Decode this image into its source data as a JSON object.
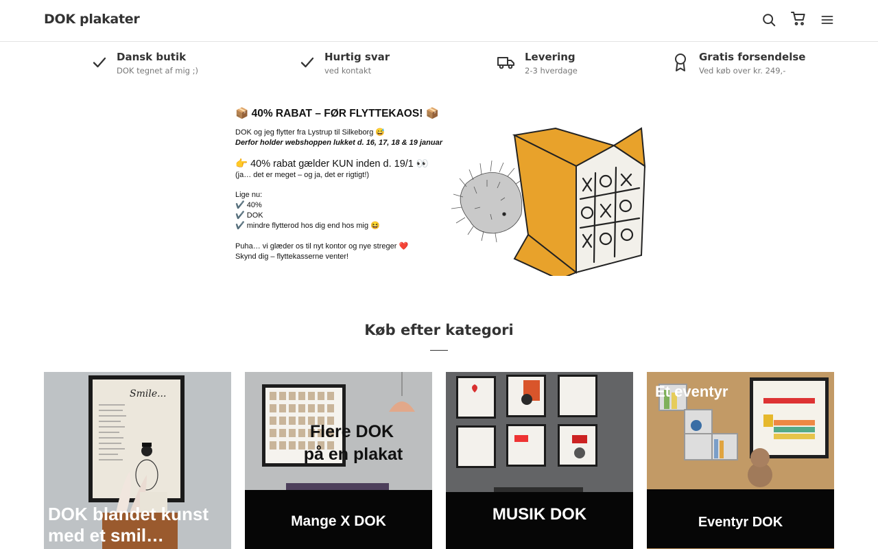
{
  "header": {
    "logo": "DOK plakater",
    "icons": [
      "search-icon",
      "cart-icon",
      "menu-icon"
    ]
  },
  "usps": [
    {
      "title": "Dansk butik",
      "subtitle": "DOK tegnet af mig ;)",
      "icon": "check-icon"
    },
    {
      "title": "Hurtig svar",
      "subtitle": "ved kontakt",
      "icon": "check-icon"
    },
    {
      "title": "Levering",
      "subtitle": "2-3 hverdage",
      "icon": "truck-icon"
    },
    {
      "title": "Gratis forsendelse",
      "subtitle": "Ved køb over kr. 249,-",
      "icon": "award-icon"
    }
  ],
  "banner": {
    "headline": "📦 40% RABAT – FØR FLYTTEKAOS! 📦",
    "line1": "DOK og jeg flytter fra Lystrup til Silkeborg 😅",
    "line2": "Derfor holder webshoppen lukket d. 16, 17, 18 & 19 januar",
    "line3": "👉 40% rabat gælder KUN inden d. 19/1 👀",
    "line4": "(ja… det er meget – og ja, det er rigtigt!)",
    "line5": "Lige nu:",
    "check1": "✔️ 40%",
    "check2": "✔️ DOK",
    "check3": "✔️ mindre flytterod hos dig end hos mig 😆",
    "line6": "Puha… vi glæder os til nyt kontor og nye streger ❤️",
    "line7": "Skynd dig – flyttekasserne venter!"
  },
  "categories_section": {
    "title": "Køb efter kategori"
  },
  "categories": [
    {
      "label_line1": "DOK blandet kunst",
      "label_line2": "med et smil…",
      "poster_text": "Smile..."
    },
    {
      "label_line1": "Mange X  DOK",
      "overlay_line1": "Flere DOK",
      "overlay_line2": "på en plakat"
    },
    {
      "label_line1": "MUSIK DOK"
    },
    {
      "label_line1": "Eventyr DOK",
      "overlay": "Et eventyr"
    }
  ],
  "colors": {
    "text": "#333333",
    "muted": "#777777",
    "border": "#e3e3e3",
    "box_orange": "#e8a22b"
  }
}
